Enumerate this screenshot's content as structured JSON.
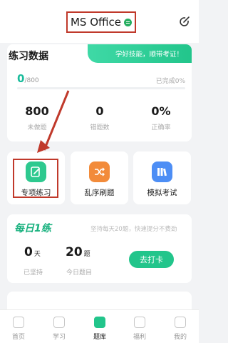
{
  "header": {
    "title": "MS Office",
    "swap_icon": "swap-icon",
    "edit_icon": "edit-icon"
  },
  "stats": {
    "title": "练习数据",
    "banner": "学好技能，顺带考证！",
    "done": "0",
    "total": "/800",
    "completion": "已完成0%",
    "progress_fraction": 0,
    "items": [
      {
        "value": "800",
        "label": "未做题"
      },
      {
        "value": "0",
        "label": "错题数"
      },
      {
        "value": "0%",
        "label": "正确率"
      }
    ]
  },
  "functions": [
    {
      "label": "专项练习",
      "icon": "pencil-note-icon",
      "color": "#2ec98f"
    },
    {
      "label": "乱序刷题",
      "icon": "shuffle-icon",
      "color": "#f28b3a"
    },
    {
      "label": "模拟考试",
      "icon": "books-icon",
      "color": "#4d8ef5"
    }
  ],
  "checkin": {
    "logo": "每日1练",
    "subtitle": "坚持每天20题，快速提分不费劲",
    "days_value": "0",
    "days_unit": "天",
    "days_label": "已坚持",
    "today_value": "20",
    "today_unit": "题",
    "today_label": "今日题目",
    "button": "去打卡"
  },
  "nav": [
    {
      "label": "首页",
      "icon": "home-icon",
      "active": false
    },
    {
      "label": "学习",
      "icon": "study-icon",
      "active": false
    },
    {
      "label": "题库",
      "icon": "question-bank-icon",
      "active": true
    },
    {
      "label": "福利",
      "icon": "gift-icon",
      "active": false
    },
    {
      "label": "我的",
      "icon": "profile-icon",
      "active": false
    }
  ],
  "colors": {
    "accent": "#22c58b",
    "annotation": "#c0392b"
  }
}
